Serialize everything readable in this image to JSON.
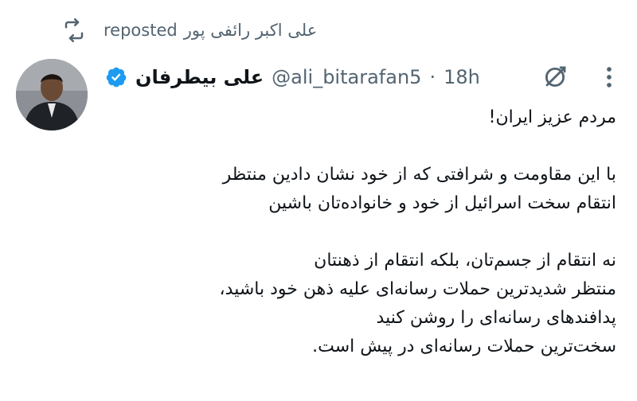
{
  "repost": {
    "icon": "repost-icon",
    "user": "علی اکبر رائفی پور",
    "label": "reposted"
  },
  "author": {
    "avatar": "avatar",
    "name": "علی بیطرفان",
    "verified_icon": "verified-badge-icon",
    "handle": "@ali_bitarafan5",
    "separator": "·",
    "time": "18h"
  },
  "actions": {
    "grok_icon": "grok-icon",
    "more_icon": "more-options-icon"
  },
  "tweet": {
    "lines": [
      "مردم عزیز ایران!",
      "",
      "با این مقاومت و شرافتی که از خود نشان دادین منتظر",
      "انتقام سخت اسرائیل از خود و خانواده‌تان باشین",
      "",
      "نه انتقام از جسم‌تان، بلکه انتقام از ذهنتان",
      "منتظر شدیدترین حملات رسانه‌ای علیه ذهن خود باشید،",
      "پدافندهای رسانه‌ای را روشن کنید",
      "سخت‌ترین حملات رسانه‌ای در پیش است."
    ]
  },
  "colors": {
    "text": "#0f1419",
    "secondary": "#536471",
    "verified": "#1d9bf0"
  }
}
